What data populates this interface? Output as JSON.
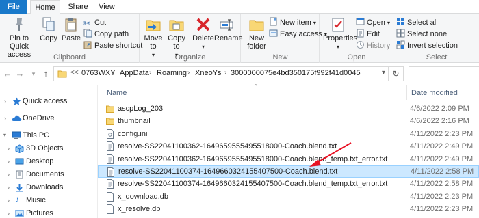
{
  "tabs": {
    "file": "File",
    "home": "Home",
    "share": "Share",
    "view": "View"
  },
  "ribbon": {
    "clipboard": {
      "label": "Clipboard",
      "pin": "Pin to Quick access",
      "copy": "Copy",
      "paste": "Paste",
      "cut": "Cut",
      "copy_path": "Copy path",
      "paste_shortcut": "Paste shortcut"
    },
    "organize": {
      "label": "Organize",
      "move_to": "Move to",
      "copy_to": "Copy to",
      "delete": "Delete",
      "rename": "Rename"
    },
    "new": {
      "label": "New",
      "new_folder": "New folder",
      "new_item": "New item",
      "easy_access": "Easy access"
    },
    "open": {
      "label": "Open",
      "properties": "Properties",
      "open": "Open",
      "edit": "Edit",
      "history": "History"
    },
    "select": {
      "label": "Select",
      "select_all": "Select all",
      "select_none": "Select none",
      "invert": "Invert selection"
    }
  },
  "address": {
    "overflow": "<<",
    "crumbs": [
      "0763WXY",
      "AppData",
      "Roaming",
      "XneoYs",
      "3000000075e4bd350175f992f41d0045"
    ]
  },
  "nav": {
    "items": [
      {
        "label": "Quick access"
      },
      {
        "label": "OneDrive"
      },
      {
        "label": "This PC"
      },
      {
        "label": "3D Objects"
      },
      {
        "label": "Desktop"
      },
      {
        "label": "Documents"
      },
      {
        "label": "Downloads"
      },
      {
        "label": "Music"
      },
      {
        "label": "Pictures"
      }
    ]
  },
  "columns": {
    "name": "Name",
    "date_modified": "Date modified"
  },
  "files": [
    {
      "name": "ascpLog_203",
      "date": "4/6/2022 2:09 PM",
      "kind": "folder"
    },
    {
      "name": "thumbnail",
      "date": "4/6/2022 2:16 PM",
      "kind": "folder"
    },
    {
      "name": "config.ini",
      "date": "4/11/2022 2:23 PM",
      "kind": "ini"
    },
    {
      "name": "resolve-SS22041100362-1649659555495518000-Coach.blend.txt",
      "date": "4/11/2022 2:49 PM",
      "kind": "txt"
    },
    {
      "name": "resolve-SS22041100362-1649659555495518000-Coach.blend_temp.txt_error.txt",
      "date": "4/11/2022 2:49 PM",
      "kind": "txt"
    },
    {
      "name": "resolve-SS22041100374-1649660324155407500-Coach.blend.txt",
      "date": "4/11/2022 2:58 PM",
      "kind": "txt",
      "selected": true
    },
    {
      "name": "resolve-SS22041100374-1649660324155407500-Coach.blend_temp.txt_error.txt",
      "date": "4/11/2022 2:58 PM",
      "kind": "txt"
    },
    {
      "name": "x_download.db",
      "date": "4/11/2022 2:23 PM",
      "kind": "db"
    },
    {
      "name": "x_resolve.db",
      "date": "4/11/2022 2:23 PM",
      "kind": "db"
    }
  ],
  "annotation": {
    "color": "#e81123"
  },
  "colors": {
    "file_tab": "#1979ca",
    "selection": "#cce8ff",
    "selection_border": "#99d1ff"
  }
}
